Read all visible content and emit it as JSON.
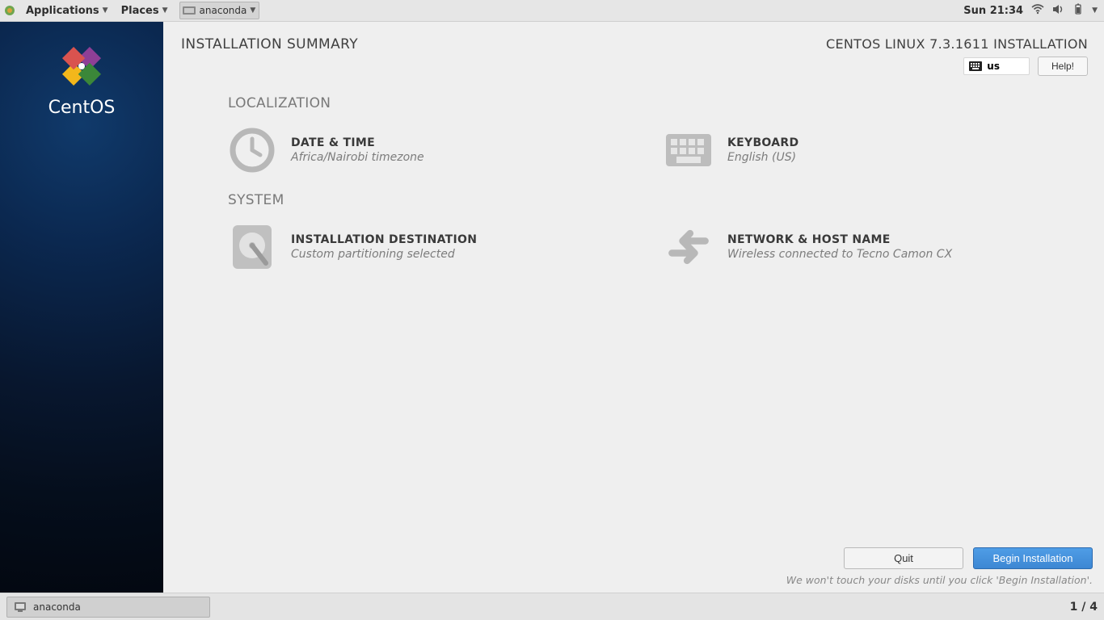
{
  "panel": {
    "applications": "Applications",
    "places": "Places",
    "task": "anaconda",
    "clock": "Sun 21:34"
  },
  "sidebar": {
    "distro": "CentOS"
  },
  "header": {
    "title": "INSTALLATION SUMMARY",
    "product": "CENTOS LINUX 7.3.1611 INSTALLATION",
    "kb_layout": "us",
    "help": "Help!"
  },
  "categories": {
    "localization": "LOCALIZATION",
    "system": "SYSTEM"
  },
  "spokes": {
    "datetime": {
      "title": "DATE & TIME",
      "status": "Africa/Nairobi timezone"
    },
    "keyboard": {
      "title": "KEYBOARD",
      "status": "English (US)"
    },
    "destination": {
      "title": "INSTALLATION DESTINATION",
      "status": "Custom partitioning selected"
    },
    "network": {
      "title": "NETWORK & HOST NAME",
      "status": "Wireless connected to Tecno Camon CX"
    }
  },
  "footer": {
    "quit": "Quit",
    "begin": "Begin Installation",
    "hint": "We won't touch your disks until you click 'Begin Installation'."
  },
  "bottom": {
    "task": "anaconda",
    "workspace": "1 / 4"
  }
}
